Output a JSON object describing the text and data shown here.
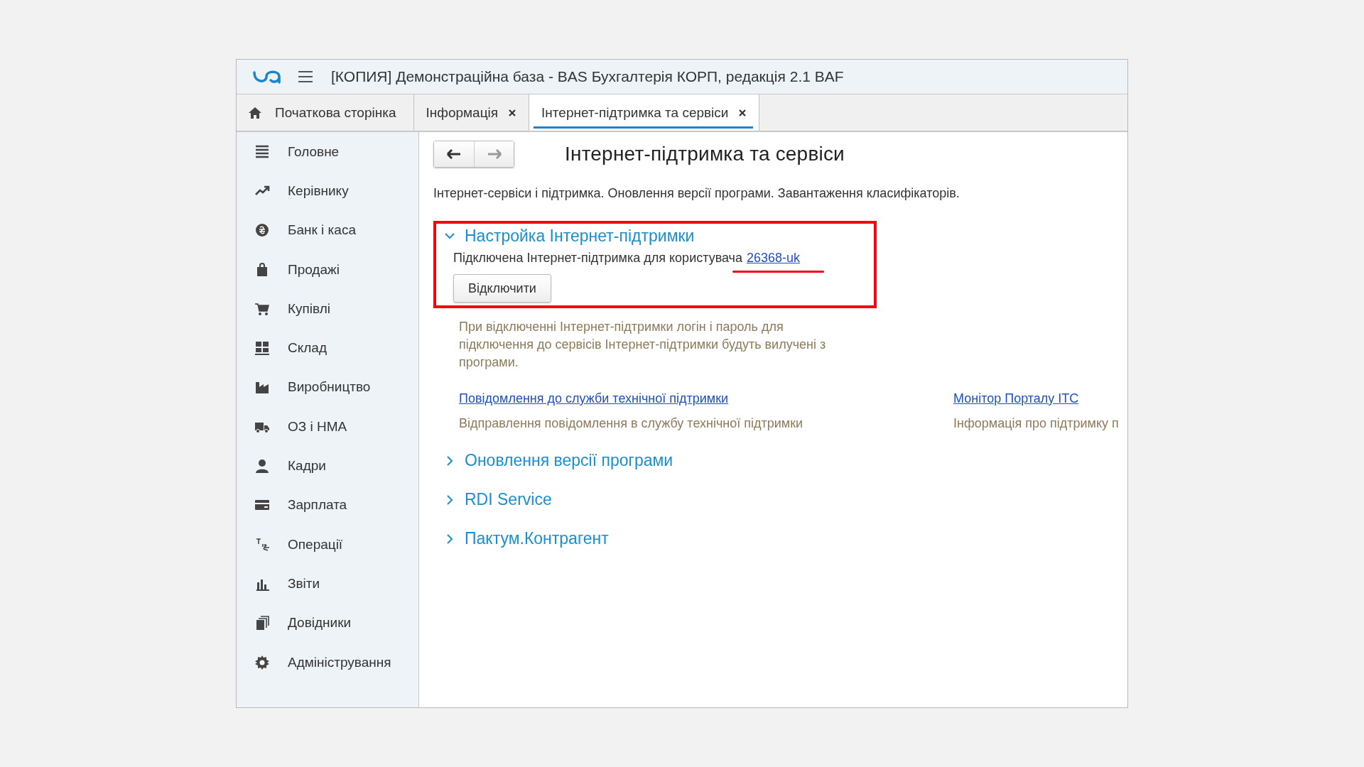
{
  "window": {
    "title": "[КОПИЯ] Демонстраційна база - BAS Бухгалтерія КОРП, редакція 2.1 BAF"
  },
  "tabs": [
    {
      "label": "Початкова сторінка",
      "kind": "home",
      "selected": false
    },
    {
      "label": "Інформація",
      "kind": "document",
      "selected": false
    },
    {
      "label": "Інтернет-підтримка та сервіси",
      "kind": "document",
      "selected": true
    }
  ],
  "sidebar": {
    "items": [
      {
        "label": "Головне"
      },
      {
        "label": "Керівнику"
      },
      {
        "label": "Банк і каса"
      },
      {
        "label": "Продажі"
      },
      {
        "label": "Купівлі"
      },
      {
        "label": "Склад"
      },
      {
        "label": "Виробництво"
      },
      {
        "label": "ОЗ і НМА"
      },
      {
        "label": "Кадри"
      },
      {
        "label": "Зарплата"
      },
      {
        "label": "Операції"
      },
      {
        "label": "Звіти"
      },
      {
        "label": "Довідники"
      },
      {
        "label": "Адміністрування"
      }
    ]
  },
  "nav": {
    "back_disabled": false,
    "forward_disabled": true
  },
  "page": {
    "title": "Інтернет-підтримка та сервіси",
    "description": "Інтернет-сервіси і підтримка. Оновлення версії програми. Завантаження класифікаторів."
  },
  "sections": [
    {
      "title": "Настройка Інтернет-підтримки",
      "expanded": true,
      "highlighted": true,
      "status_text": "Підключена Інтернет-підтримка для користувача",
      "user_link": "26368-uk",
      "user_link_marked": true,
      "button": "Відключити",
      "note": "При відключенні Інтернет-підтримки логін і пароль для підключення до сервісів Інтернет-підтримки будуть вилучені з програми.",
      "links": [
        {
          "label": "Повідомлення до служби технічної підтримки",
          "description": "Відправлення повідомлення в службу технічної підтримки"
        },
        {
          "label": "Монітор Порталу ІТС",
          "description": "Інформація про підтримку п"
        }
      ]
    },
    {
      "title": "Оновлення версії програми",
      "expanded": false,
      "highlighted": false
    },
    {
      "title": "RDI Service",
      "expanded": false,
      "highlighted": false
    },
    {
      "title": "Пактум.Контрагент",
      "expanded": false,
      "highlighted": false
    }
  ]
}
